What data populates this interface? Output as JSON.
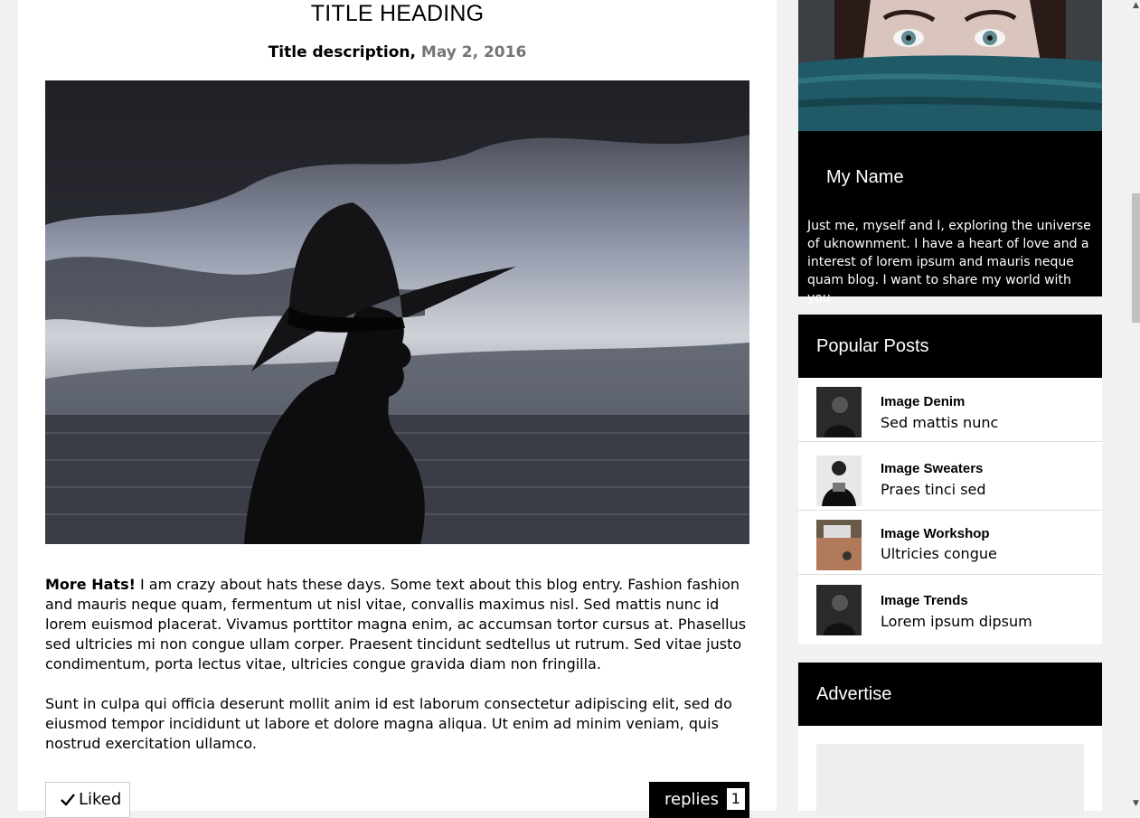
{
  "post": {
    "title": "TITLE HEADING",
    "description": "Title description,",
    "date": "May 2, 2016",
    "lead": "More Hats!",
    "paragraph1": " I am crazy about hats these days. Some text about this blog entry. Fashion fashion and mauris neque quam, fermentum ut nisl vitae, convallis maximus nisl. Sed mattis nunc id lorem euismod placerat. Vivamus porttitor magna enim, ac accumsan tortor cursus at. Phasellus sed ultricies mi non congue ullam corper. Praesent tincidunt sedtellus ut rutrum. Sed vitae justo condimentum, porta lectus vitae, ultricies congue gravida diam non fringilla.",
    "paragraph2": "Sunt in culpa qui officia deserunt mollit anim id est laborum consectetur adipiscing elit, sed do eiusmod tempor incididunt ut labore et dolore magna aliqua. Ut enim ad minim veniam, quis nostrud exercitation ullamco.",
    "liked_label": "Liked",
    "replies_label": "replies",
    "replies_count": "1"
  },
  "profile": {
    "name": "My Name",
    "bio": "Just me, myself and I, exploring the universe of uknownment. I have a heart of love and a interest of lorem ipsum and mauris neque quam blog. I want to share my world with you."
  },
  "popular": {
    "heading": "Popular Posts",
    "items": [
      {
        "title": "Image Denim",
        "subtitle": "Sed mattis nunc"
      },
      {
        "title": "Image Sweaters",
        "subtitle": "Praes tinci sed"
      },
      {
        "title": "Image Workshop",
        "subtitle": "Ultricies congue"
      },
      {
        "title": "Image Trends",
        "subtitle": "Lorem ipsum dipsum"
      }
    ]
  },
  "advertise": {
    "heading": "Advertise"
  },
  "colors": {
    "background": "#f1f1f1",
    "panel_header": "#000000",
    "date_text": "#757575"
  }
}
